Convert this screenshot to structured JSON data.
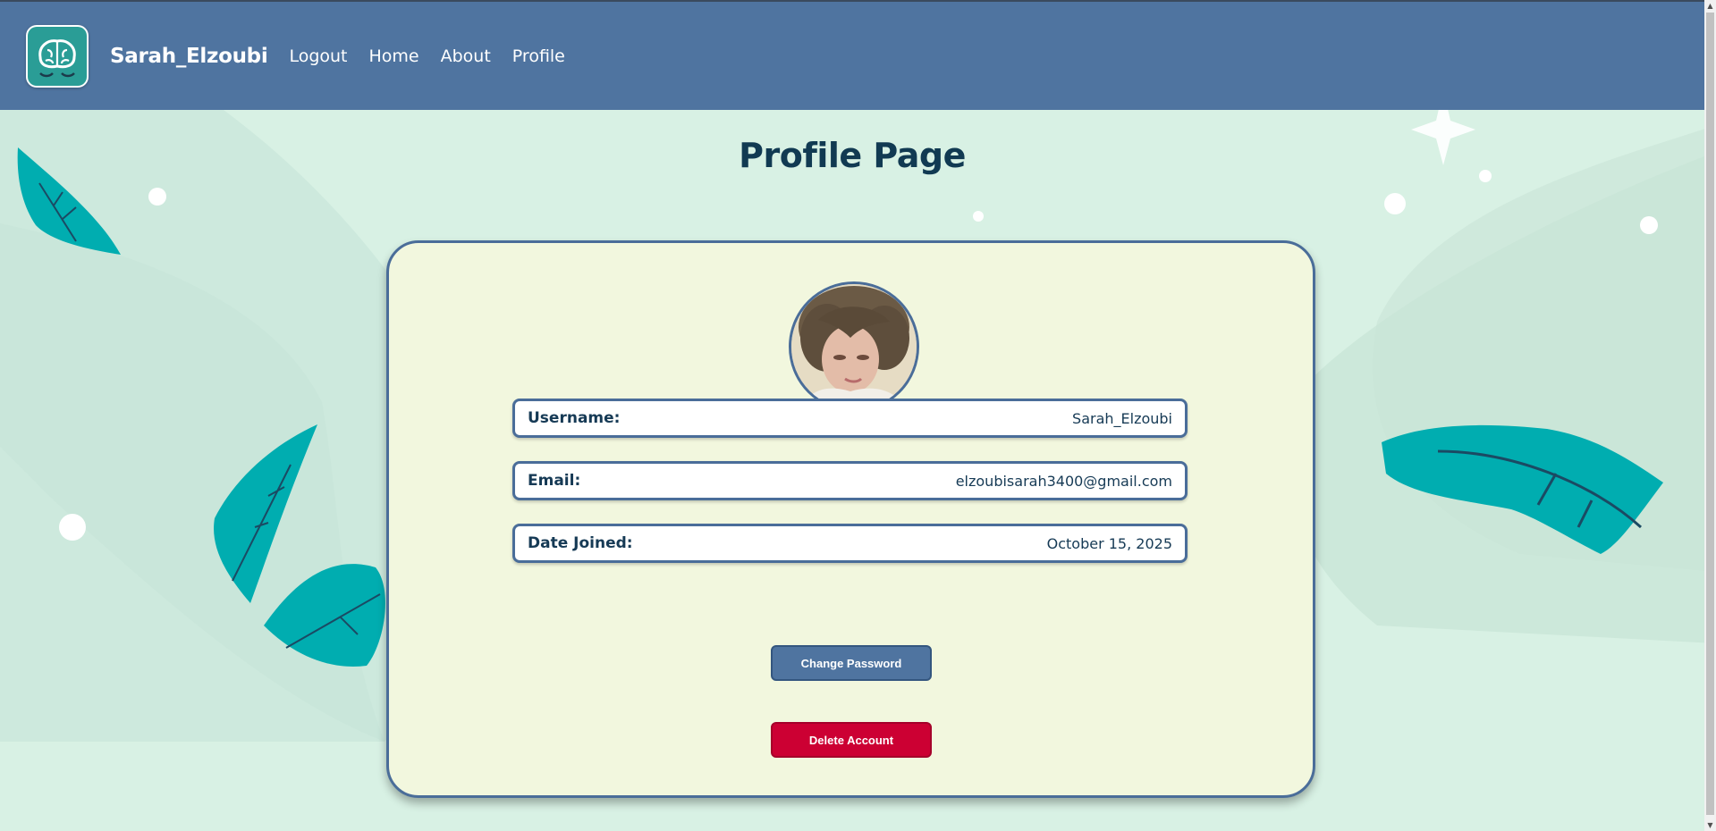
{
  "navbar": {
    "brand": "Sarah_Elzoubi",
    "links": [
      "Logout",
      "Home",
      "About",
      "Profile"
    ]
  },
  "page": {
    "title": "Profile Page"
  },
  "profile": {
    "fields": [
      {
        "label": "Username:",
        "value": "Sarah_Elzoubi"
      },
      {
        "label": "Email:",
        "value": "elzoubisarah3400@gmail.com"
      },
      {
        "label": "Date Joined:",
        "value": "October 15, 2025"
      }
    ]
  },
  "actions": {
    "change_password": "Change Password",
    "delete_account": "Delete Account"
  },
  "icons": {
    "logo": "brain-logo-icon",
    "avatar": "user-avatar"
  },
  "colors": {
    "navbar": "#4f74a0",
    "card_bg": "#f2f7de",
    "border": "#4a6d99",
    "delete": "#cc0033",
    "leaf": "#00adb0",
    "title": "#113a52"
  }
}
